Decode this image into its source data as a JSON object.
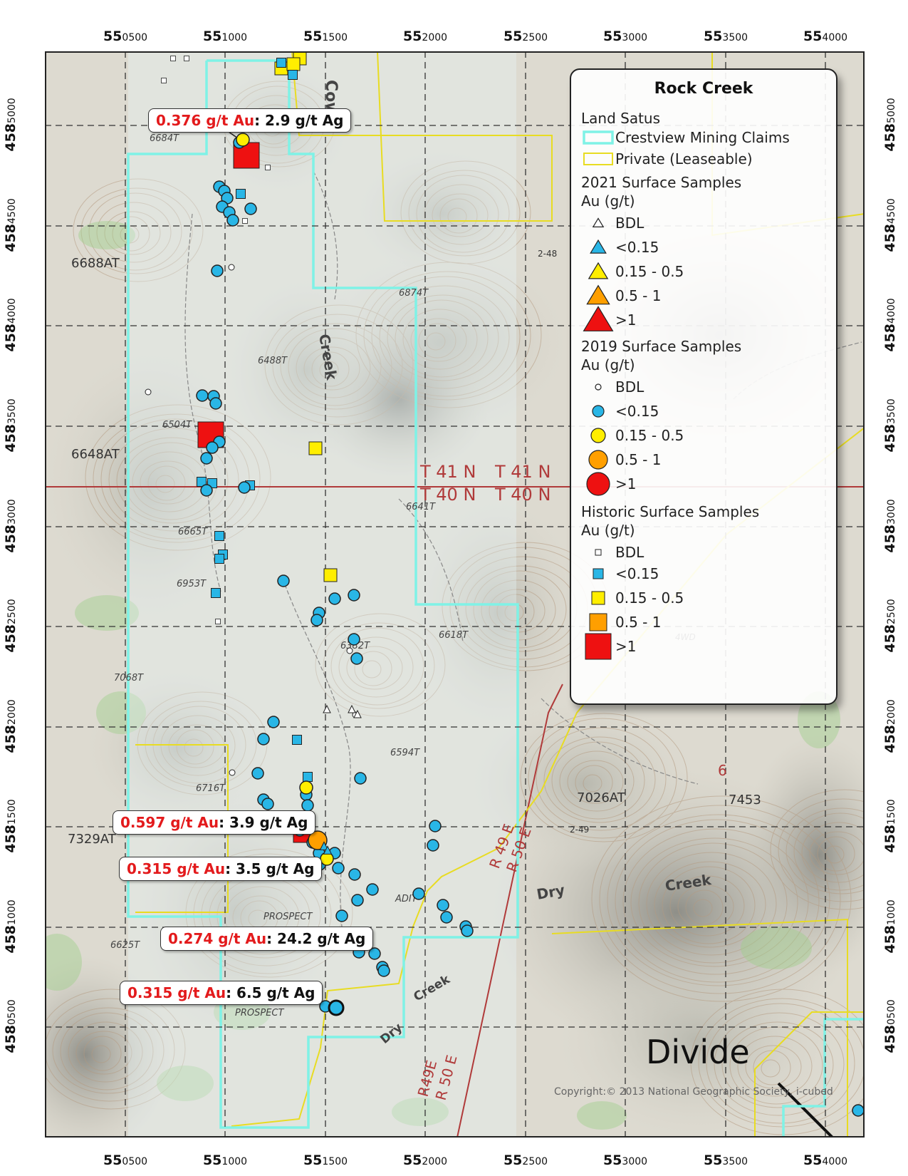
{
  "grid": {
    "easting_labels": [
      {
        "prefix": "55",
        "suffix": "0500"
      },
      {
        "prefix": "55",
        "suffix": "1000"
      },
      {
        "prefix": "55",
        "suffix": "1500"
      },
      {
        "prefix": "55",
        "suffix": "2000"
      },
      {
        "prefix": "55",
        "suffix": "2500"
      },
      {
        "prefix": "55",
        "suffix": "3000"
      },
      {
        "prefix": "55",
        "suffix": "3500"
      },
      {
        "prefix": "55",
        "suffix": "4000"
      }
    ],
    "northing_labels": [
      {
        "prefix": "458",
        "suffix": "5000"
      },
      {
        "prefix": "458",
        "suffix": "4500"
      },
      {
        "prefix": "458",
        "suffix": "4000"
      },
      {
        "prefix": "458",
        "suffix": "3500"
      },
      {
        "prefix": "458",
        "suffix": "3000"
      },
      {
        "prefix": "458",
        "suffix": "2500"
      },
      {
        "prefix": "458",
        "suffix": "2000"
      },
      {
        "prefix": "458",
        "suffix": "1500"
      },
      {
        "prefix": "458",
        "suffix": "1000"
      },
      {
        "prefix": "458",
        "suffix": "0500"
      }
    ]
  },
  "legend": {
    "title": "Rock Creek",
    "land_status_heading": "Land Satus",
    "crestview_label": "Crestview Mining Claims",
    "private_label": "Private (Leaseable)",
    "s2021_heading": "2021 Surface Samples",
    "s2019_heading": "2019 Surface Samples",
    "historic_heading": "Historic Surface Samples",
    "unit_label": "Au (g/t)",
    "classes": [
      "BDL",
      "<0.15",
      "0.15 - 0.5",
      "0.5 - 1",
      ">1"
    ]
  },
  "colors": {
    "claims": "#7ff2e6",
    "private": "#e8dc22",
    "bdl": "#ffffff",
    "lt015": "#29b6e6",
    "c015_05": "#ffee00",
    "c05_1": "#ff9f00",
    "gt1": "#ee1111",
    "callout_au": "#e31a1c"
  },
  "callouts": [
    {
      "au": "0.376 g/t Au",
      "ag": ": 2.9 g/t Ag"
    },
    {
      "au": "0.597 g/t Au",
      "ag": ": 3.9 g/t Ag"
    },
    {
      "au": "0.315 g/t Au",
      "ag": ": 3.5 g/t Ag"
    },
    {
      "au": "0.274 g/t Au",
      "ag": ": 24.2 g/t Ag"
    },
    {
      "au": "0.315 g/t Au",
      "ag": ": 6.5 g/t Ag"
    }
  ],
  "map_labels": {
    "cow": "Cow",
    "creek_upper": "Creek",
    "creek_dry": "Creek",
    "dry": "Dry",
    "dry_lower": "Dry",
    "creek_lower": "Creek",
    "t41n_a": "T 41 N",
    "t41n_b": "T 41 N",
    "t40n_a": "T 40 N",
    "t40n_b": "T 40 N",
    "r49e": "R 49 E",
    "r50e": "R 50 E",
    "r49e_b": "R49E",
    "r50e_b": "R 50 E",
    "spot_6688": "6688AT",
    "spot_6648": "6648AT",
    "spot_7329": "7329AT",
    "spot_7026": "7026AT",
    "spot_7453": "7453",
    "spot_6684": "6684T",
    "spot_6488": "6488T",
    "spot_6504": "6504T",
    "spot_6953": "6953T",
    "spot_6665": "6665T",
    "spot_6382": "6382T",
    "spot_6618": "6618T",
    "spot_6594": "6594T",
    "spot_6625": "6625T",
    "spot_7068": "7068T",
    "spot_6641": "6641T",
    "spot_6716": "6716T",
    "spot_6874": "6874T",
    "prospect_1": "PROSPECT",
    "prospect_2": "PROSPECT",
    "adit": "ADIT",
    "bm_248": "2-48",
    "bm_249": "2-49",
    "sec_6": "6",
    "road_4wd": "4WD",
    "divide": "Divide",
    "copyright": "Copyright:© 2013 National Geographic Society, i-cubed"
  }
}
